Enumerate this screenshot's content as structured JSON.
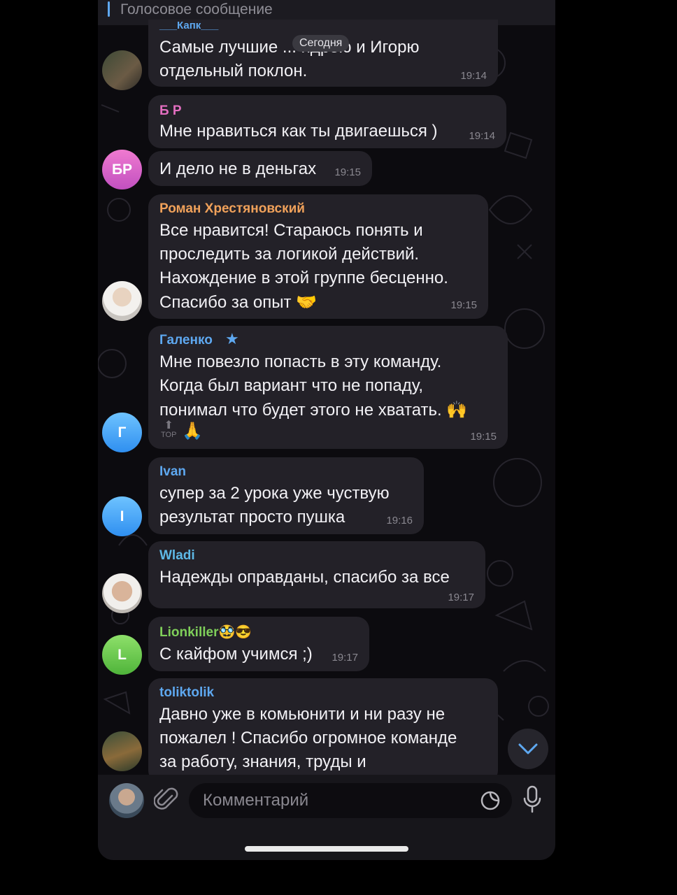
{
  "pinned": {
    "label": "Голосовое сообщение"
  },
  "date_badge": "Сегодня",
  "messages": [
    {
      "author": "___Капк___",
      "lines": [
        "Самые лучшие ... ндрею и Игорю",
        "отдельный поклон."
      ],
      "time": "19:14"
    },
    {
      "author": "Б Р",
      "lines": [
        "Мне нравиться как ты двигаешься )"
      ],
      "time": "19:14"
    },
    {
      "author": "",
      "lines": [
        "И дело не в деньгах"
      ],
      "time": "19:15",
      "avatar": "БР"
    },
    {
      "author": "Роман Хрестяновский",
      "lines": [
        "Все нравится! Стараюсь понять и",
        "проследить за логикой действий.",
        "Нахождение в этой группе бесценно.",
        "Спасибо за опыт 🤝"
      ],
      "time": "19:15"
    },
    {
      "author": "Галенко",
      "lines": [
        "Мне повезло попасть в эту команду.",
        "Когда был вариант что не попаду,",
        "понимал что будет этого не хватать. 🙌"
      ],
      "reactions": [
        "TOP",
        "🙏"
      ],
      "time": "19:15",
      "avatar": "Г"
    },
    {
      "author": "Ivan",
      "lines": [
        "супер за 2 урока уже чуствую",
        "результат просто пушка"
      ],
      "time": "19:16",
      "avatar": "I"
    },
    {
      "author": "Wladi",
      "lines": [
        "Надежды оправданы, спасибо за все"
      ],
      "time": "19:17"
    },
    {
      "author": "Lionkiller🥸😎",
      "lines": [
        "С кайфом учимся ;)"
      ],
      "time": "19:17",
      "avatar": "L"
    },
    {
      "author": "toliktolik",
      "lines": [
        "Давно уже в комьюнити и ни разу не",
        "пожалел ! Спасибо огромное команде",
        "за работу, знания, труды и"
      ],
      "time": ""
    }
  ],
  "composer": {
    "placeholder": "Комментарий"
  },
  "colors": {
    "name_br": "#e36ec0",
    "name_roman": "#f0a15a",
    "name_galenko": "#5ea8f0",
    "name_ivan": "#5ea8f0",
    "name_wladi": "#5eb8e6",
    "name_lion": "#7fcf5a",
    "name_tolik": "#5ea8f0"
  }
}
